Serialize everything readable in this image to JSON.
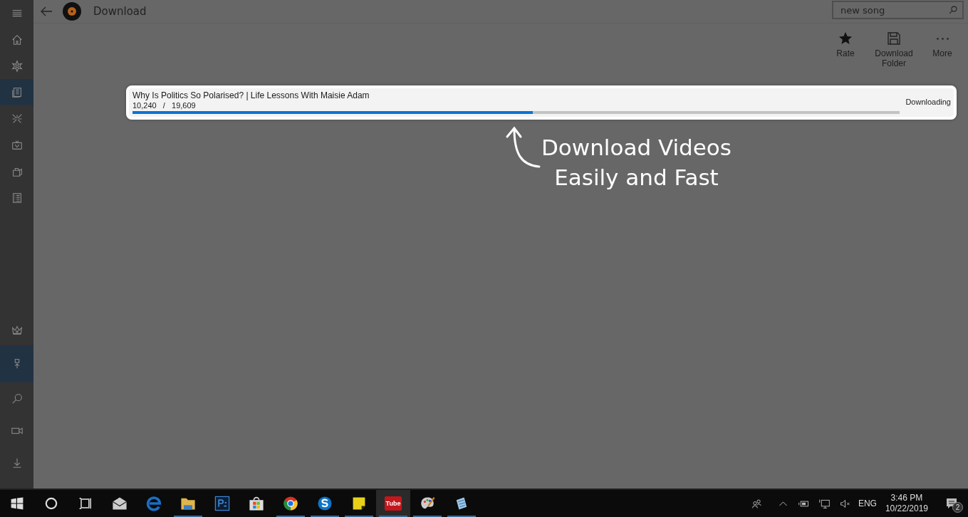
{
  "sidebar": {
    "top_items": [
      {
        "kind": "menu",
        "selected": false
      },
      {
        "kind": "home",
        "selected": false
      },
      {
        "kind": "burst",
        "selected": false
      },
      {
        "kind": "news",
        "selected": true
      },
      {
        "kind": "sparkle",
        "selected": false
      },
      {
        "kind": "tv",
        "selected": false
      },
      {
        "kind": "bag",
        "selected": false
      },
      {
        "kind": "list",
        "selected": false
      }
    ],
    "bottom_items": [
      {
        "kind": "crown",
        "selected": false
      },
      {
        "kind": "upload",
        "selected": true
      },
      {
        "kind": "search",
        "selected": false
      },
      {
        "kind": "camera",
        "selected": false
      },
      {
        "kind": "download",
        "selected": false
      }
    ]
  },
  "header": {
    "title": "Download",
    "search": {
      "value": "new song"
    }
  },
  "toolbar": [
    {
      "kind": "star",
      "label": "Rate"
    },
    {
      "kind": "floppy",
      "label": "Download Folder"
    },
    {
      "kind": "dots",
      "label": "More"
    }
  ],
  "downloads": [
    {
      "title": "Why Is Politics So Polarised? | Life Lessons With Maisie Adam",
      "progress_text": "10,240   /   19,609",
      "level": 0.522,
      "status": "Downloading"
    }
  ],
  "callout": {
    "lines": [
      "Download Videos",
      "Easily and Fast"
    ]
  },
  "taskbar": {
    "apps": [
      {
        "kind": "windows",
        "running": false,
        "selected": false
      },
      {
        "kind": "cortana",
        "running": false,
        "selected": false
      },
      {
        "kind": "taskview",
        "running": false,
        "selected": false
      },
      {
        "kind": "mail",
        "running": false,
        "selected": false
      },
      {
        "kind": "edge",
        "running": false,
        "selected": false
      },
      {
        "kind": "folder",
        "running": true,
        "selected": false
      },
      {
        "kind": "ps",
        "running": false,
        "selected": false
      },
      {
        "kind": "store",
        "running": false,
        "selected": false
      },
      {
        "kind": "chrome",
        "running": true,
        "selected": false
      },
      {
        "kind": "skype",
        "running": true,
        "selected": false
      },
      {
        "kind": "sticky",
        "running": true,
        "selected": false
      },
      {
        "kind": "tube",
        "label": "Tube",
        "running": true,
        "selected": true
      },
      {
        "kind": "paint",
        "running": true,
        "selected": false
      },
      {
        "kind": "notepad",
        "running": true,
        "selected": false
      }
    ],
    "tray": {
      "language": "ENG",
      "time": "3:46 PM",
      "date": "10/22/2019",
      "notifications": "2"
    }
  }
}
